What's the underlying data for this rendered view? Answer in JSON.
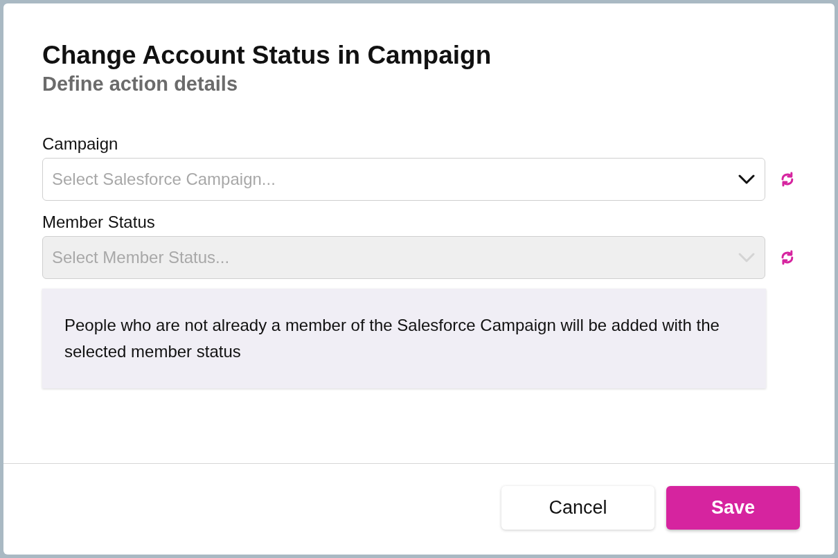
{
  "dialog": {
    "title": "Change Account Status in Campaign",
    "subtitle": "Define action details",
    "fields": [
      {
        "label": "Campaign",
        "placeholder": "Select Salesforce Campaign...",
        "disabled": false
      },
      {
        "label": "Member Status",
        "placeholder": "Select Member Status...",
        "disabled": true
      }
    ],
    "info": "People who are not already a member of the Salesforce Campaign will be added with the selected member status",
    "buttons": [
      {
        "label": "Cancel",
        "kind": "secondary"
      },
      {
        "label": "Save",
        "kind": "primary"
      }
    ]
  }
}
